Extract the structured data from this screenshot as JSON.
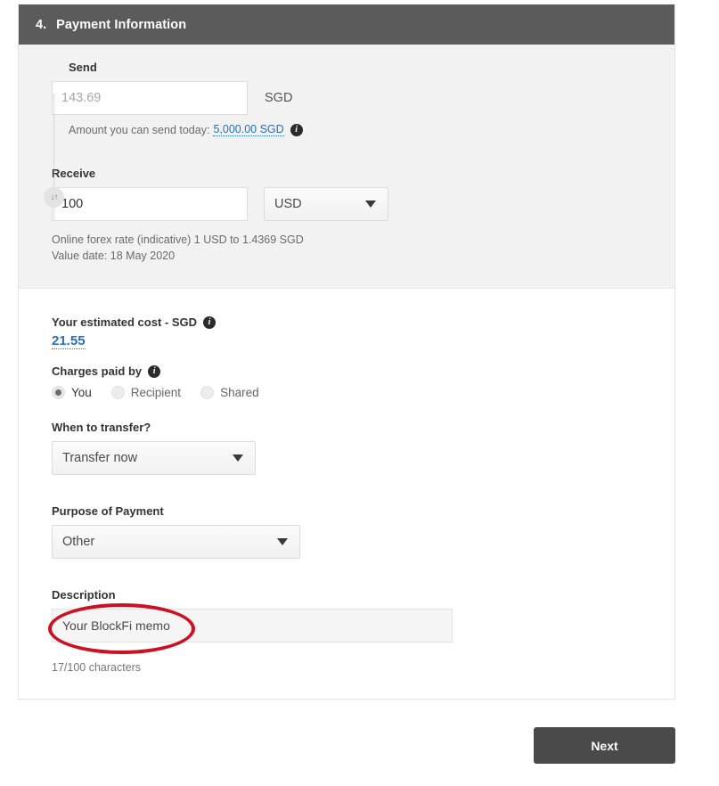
{
  "card": {
    "header": {
      "step_number": "4.",
      "title": "Payment Information"
    }
  },
  "fx_panel": {
    "send": {
      "label": "Send",
      "placeholder": "143.69",
      "value": "",
      "currency": "SGD",
      "limit_prefix": "Amount you can send today:",
      "limit_value": "5,000.00 SGD",
      "limit_info_icon": "info-icon"
    },
    "swap_icon": "swap-vertical-icon",
    "receive": {
      "label": "Receive",
      "value": "100",
      "placeholder": "",
      "currency": "USD"
    },
    "rate_note": "Online forex rate (indicative) 1 USD to 1.4369 SGD",
    "value_date_note": "Value date: 18 May 2020"
  },
  "details": {
    "estimated_cost": {
      "label": "Your estimated cost - SGD",
      "info_icon": "info-icon",
      "value": "21.55"
    },
    "charges_paid_by": {
      "label": "Charges paid by",
      "info_icon": "info-icon",
      "options": [
        {
          "label": "You",
          "selected": true
        },
        {
          "label": "Recipient",
          "selected": false
        },
        {
          "label": "Shared",
          "selected": false
        }
      ]
    },
    "when_to_transfer": {
      "label": "When to transfer?",
      "value": "Transfer now",
      "caret_icon": "chevron-down-icon"
    },
    "purpose_of_payment": {
      "label": "Purpose of Payment",
      "value": "Other",
      "caret_icon": "chevron-down-icon"
    },
    "description": {
      "label": "Description",
      "value": "Your BlockFi memo",
      "placeholder": "",
      "char_count": "17/100 characters",
      "annotation": "red-ellipse-highlight"
    }
  },
  "footer": {
    "next_label": "Next"
  },
  "colors": {
    "header_bar": "#5b5b5b",
    "panel_bg": "#f2f2f2",
    "link_blue": "#2a6ebb",
    "annotation_red": "#cc1122",
    "next_button": "#4a4a4a"
  }
}
